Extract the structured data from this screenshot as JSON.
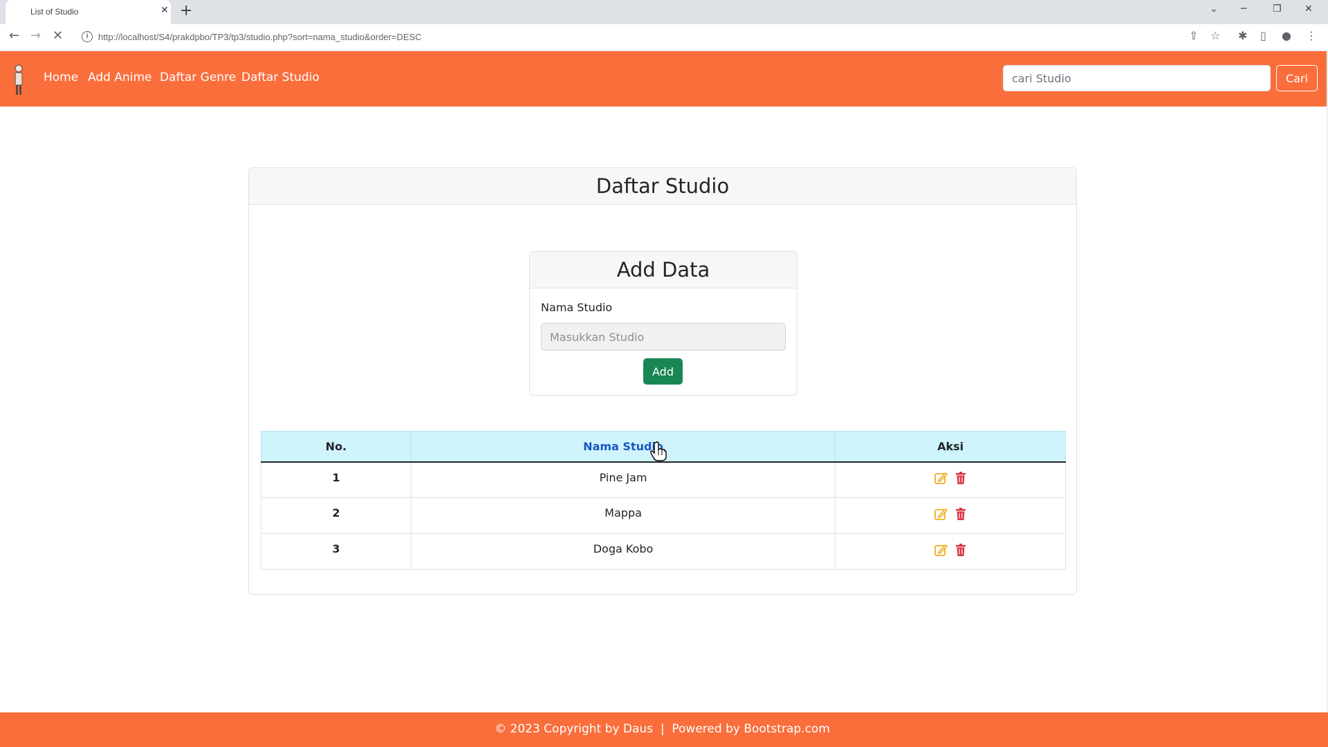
{
  "browser": {
    "tab_title": "List of Studio",
    "tab_close": "✕",
    "new_tab": "+",
    "url": "http://localhost/S4/prakdpbo/TP3/tp3/studio.php?sort=nama_studio&order=DESC"
  },
  "navbar": {
    "links": [
      "Home",
      "Add Anime",
      "Daftar Genre",
      "Daftar Studio"
    ],
    "search_placeholder": "cari Studio",
    "search_button": "Cari"
  },
  "page": {
    "title": "Daftar Studio"
  },
  "form": {
    "title": "Add Data",
    "label": "Nama Studio",
    "placeholder": "Masukkan Studio",
    "button": "Add"
  },
  "table": {
    "headers": {
      "no": "No.",
      "name": "Nama Studio",
      "action": "Aksi"
    },
    "rows": [
      {
        "no": "1",
        "name": "Pine Jam"
      },
      {
        "no": "2",
        "name": "Mappa"
      },
      {
        "no": "3",
        "name": "Doga Kobo"
      }
    ]
  },
  "footer": {
    "text": "© 2023 Copyright by Daus  |  Powered by Bootstrap.com"
  },
  "colors": {
    "brand": "#fa6e3c",
    "add_button": "#198754",
    "edit_icon": "#f0ad1e",
    "delete_icon": "#dc3545",
    "table_header": "#cff4fc"
  }
}
